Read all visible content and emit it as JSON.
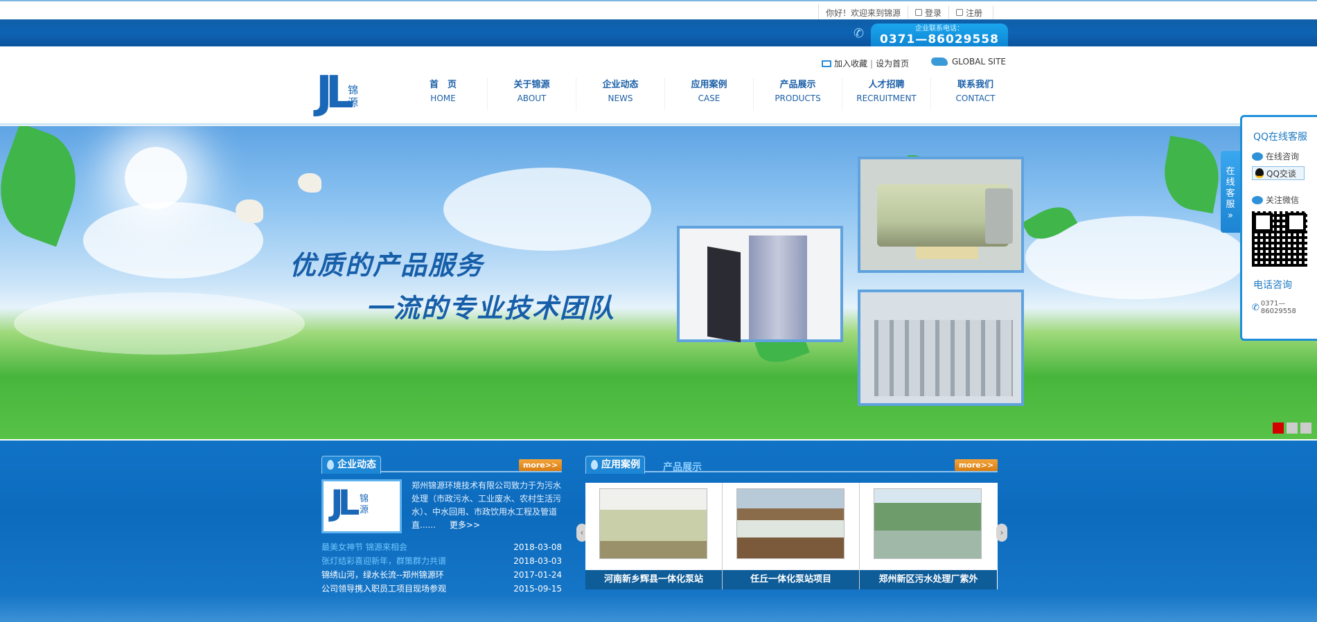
{
  "topbar": {
    "welcome": "你好！欢迎来到锦源",
    "login": "登录",
    "register": "注册"
  },
  "phone": {
    "label": "企业联系电话：",
    "number": "0371—86029558"
  },
  "header": {
    "favorite": "加入收藏",
    "homepage": "设为首页",
    "global": "GLOBAL SITE",
    "logo_mark": "JL",
    "logo_text": "锦源"
  },
  "nav": [
    {
      "cn": "首　页",
      "en": "HOME"
    },
    {
      "cn": "关于锦源",
      "en": "ABOUT"
    },
    {
      "cn": "企业动态",
      "en": "NEWS"
    },
    {
      "cn": "应用案例",
      "en": "CASE"
    },
    {
      "cn": "产品展示",
      "en": "PRODUCTS"
    },
    {
      "cn": "人才招聘",
      "en": "RECRUITMENT"
    },
    {
      "cn": "联系我们",
      "en": "CONTACT"
    }
  ],
  "banner": {
    "slogan1": "优质的产品服务",
    "slogan2": "一流的专业技术团队",
    "active_slide": 1,
    "slide_count": 3
  },
  "qq": {
    "tab": "在线客服",
    "title": "QQ在线客服",
    "online": "在线咨询",
    "qq_btn": "QQ交谈",
    "wechat": "关注微信",
    "phone_title": "电话咨询",
    "phone": "0371—86029558"
  },
  "news": {
    "title": "企业动态",
    "more": "more>>",
    "intro": "郑州锦源环境技术有限公司致力于为污水处理（市政污水、工业废水、农村生活污水）、中水回用、市政饮用水工程及管道直......",
    "intro_more": "更多>>",
    "items": [
      {
        "title": "最美女神节 锦源来相会",
        "date": "2018-03-08"
      },
      {
        "title": "张灯结彩喜迎新年，群策群力共谱",
        "date": "2018-03-03"
      },
      {
        "title": "锦绣山河，绿水长流--郑州锦源环",
        "date": "2017-01-24"
      },
      {
        "title": "公司领导携入职员工项目现场参观",
        "date": "2015-09-15"
      }
    ]
  },
  "cases": {
    "tab_active": "应用案例",
    "tab_other": "产品展示",
    "more": "more>>",
    "items": [
      {
        "caption": "河南新乡辉县一体化泵站"
      },
      {
        "caption": "任丘一体化泵站项目"
      },
      {
        "caption": "郑州新区污水处理厂紫外"
      }
    ],
    "prev": "‹",
    "next": "›"
  }
}
